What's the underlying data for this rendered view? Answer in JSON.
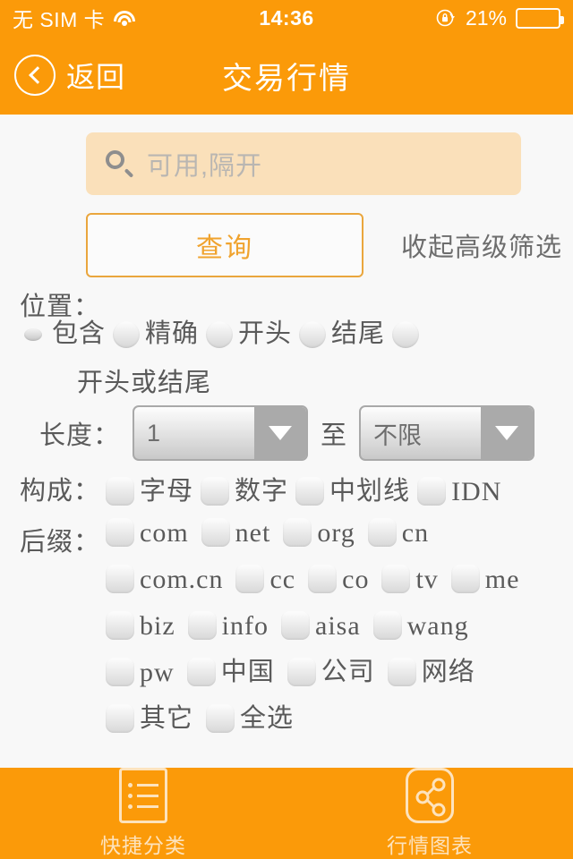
{
  "statusbar": {
    "carrier": "无 SIM 卡",
    "wifi_icon": "wifi-icon",
    "time": "14:36",
    "rotation_lock_icon": "rotation-lock-icon",
    "battery_percent": "21%",
    "battery_level": 21
  },
  "navbar": {
    "back_label": "返回",
    "back_icon": "chevron-left-icon",
    "title": "交易行情"
  },
  "search": {
    "icon": "search-icon",
    "placeholder": "可用,隔开",
    "value": ""
  },
  "actions": {
    "query_label": "查询",
    "toggle_advanced_label": "收起高级筛选"
  },
  "filters": {
    "position": {
      "label": "位置：",
      "options": [
        {
          "text": "包含",
          "selected": true
        },
        {
          "text": "精确",
          "selected": false
        },
        {
          "text": "开头",
          "selected": false
        },
        {
          "text": "结尾",
          "selected": false
        },
        {
          "text": "开头或结尾",
          "selected": false
        }
      ]
    },
    "length": {
      "label": "长度：",
      "from_value": "1",
      "middle_label": "至",
      "to_value": "不限"
    },
    "composition": {
      "label": "构成：",
      "options": [
        "字母",
        "数字",
        "中划线",
        "IDN"
      ]
    },
    "suffix": {
      "label": "后缀：",
      "options": [
        "com",
        "net",
        "org",
        "cn",
        "com.cn",
        "cc",
        "co",
        "tv",
        "me",
        "biz",
        "info",
        "aisa",
        "wang",
        "pw",
        "中国",
        "公司",
        "网络",
        "其它",
        "全选"
      ]
    }
  },
  "tabbar": {
    "items": [
      {
        "label": "快捷分类",
        "icon": "list-icon"
      },
      {
        "label": "行情图表",
        "icon": "share-graph-icon"
      }
    ]
  },
  "colors": {
    "brand_orange": "#fb9a09",
    "search_field": "#fae0ba",
    "accent_text": "#f0a32e",
    "tab_label": "#fde3bd"
  }
}
